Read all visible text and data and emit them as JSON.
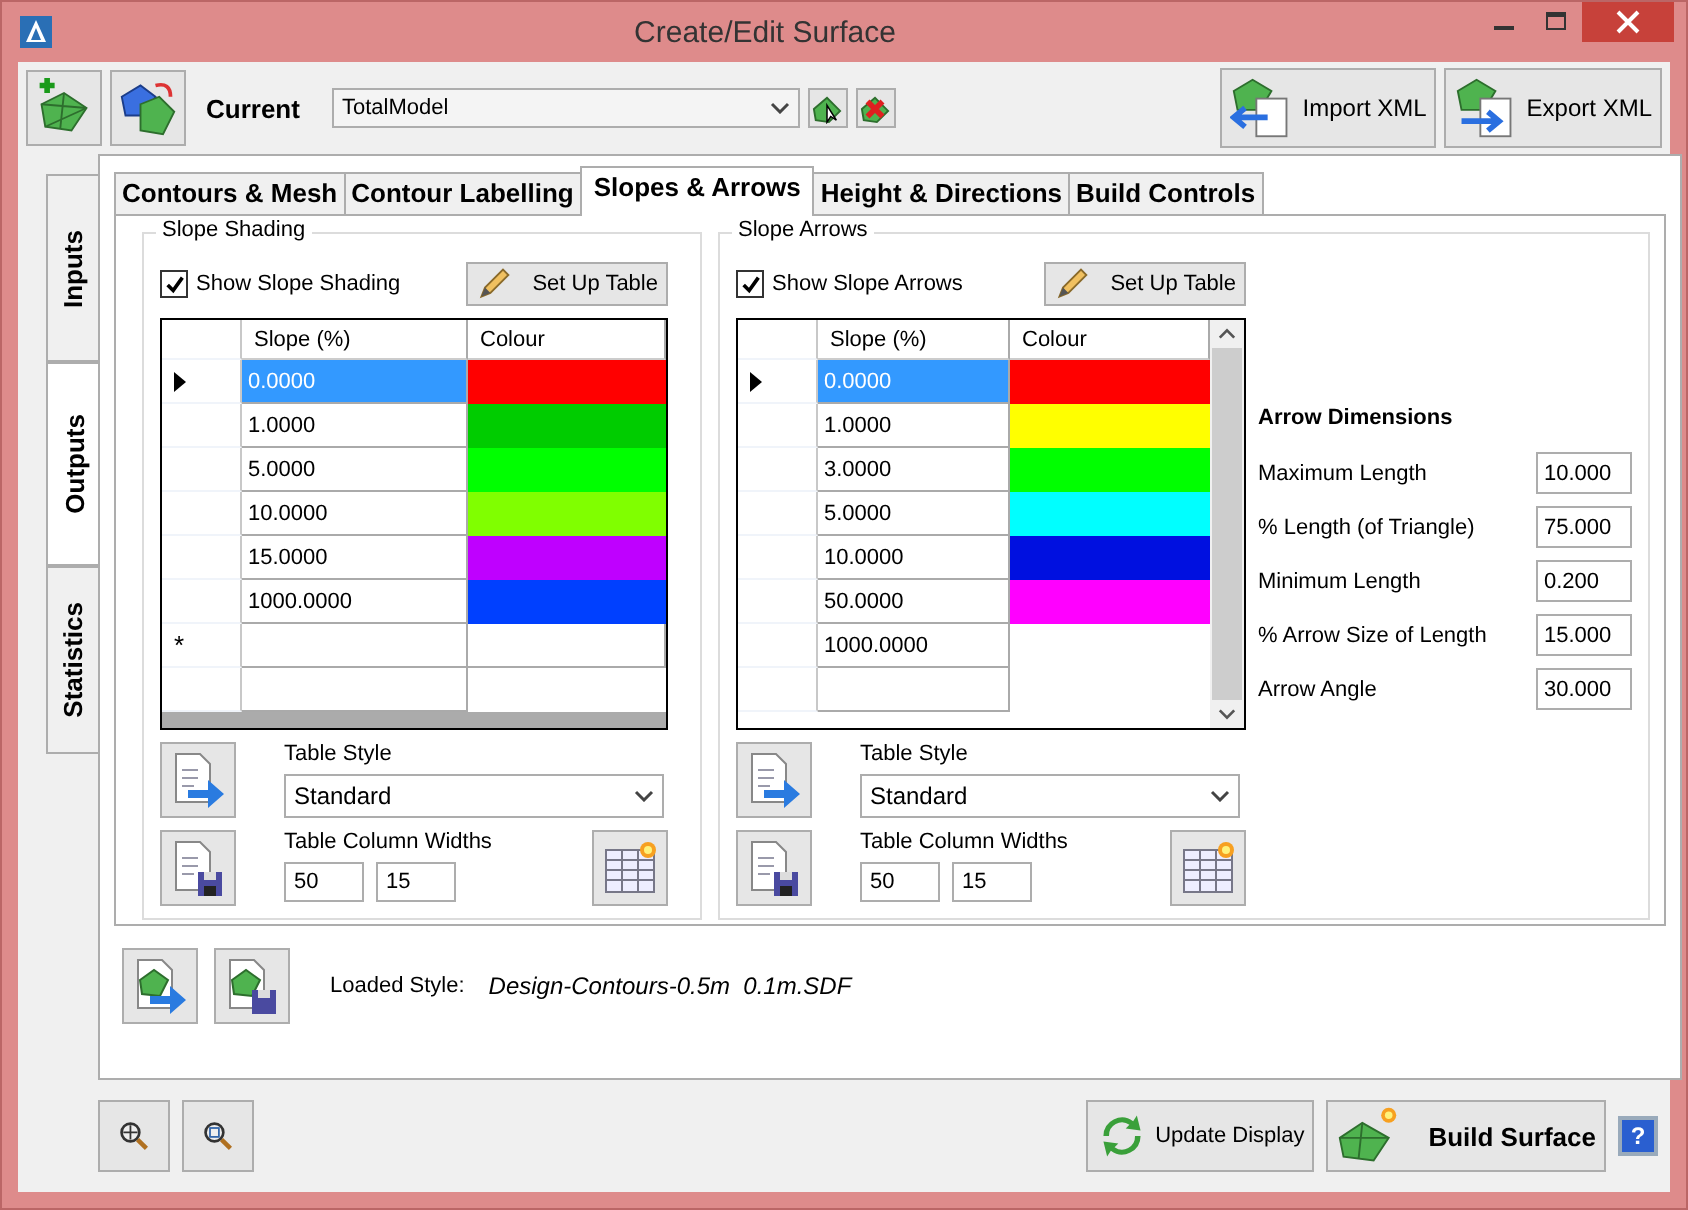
{
  "window": {
    "title": "Create/Edit Surface"
  },
  "toolbar": {
    "current_label": "Current",
    "current_value": "TotalModel",
    "import_button": "Import XML",
    "export_button": "Export XML"
  },
  "side_tabs": [
    {
      "label": "Inputs",
      "selected": false
    },
    {
      "label": "Outputs",
      "selected": true
    },
    {
      "label": "Statistics",
      "selected": false
    }
  ],
  "tabs": [
    {
      "label": "Contours & Mesh",
      "selected": false
    },
    {
      "label": "Contour Labelling",
      "selected": false
    },
    {
      "label": "Slopes & Arrows",
      "selected": true
    },
    {
      "label": "Height & Directions",
      "selected": false
    },
    {
      "label": "Build Controls",
      "selected": false
    }
  ],
  "panels": [
    {
      "title": "Slope Shading",
      "show_label": "Show Slope Shading",
      "checked": true,
      "setup_button": "Set Up Table",
      "columns": [
        "Slope (%)",
        "Colour"
      ],
      "scrollable": false,
      "new_row_marker": "*",
      "rows": [
        {
          "slope": "0.0000",
          "color": "#ff0000",
          "selected": true
        },
        {
          "slope": "1.0000",
          "color": "#00cc00",
          "selected": false
        },
        {
          "slope": "5.0000",
          "color": "#00ff00",
          "selected": false
        },
        {
          "slope": "10.0000",
          "color": "#80ff00",
          "selected": false
        },
        {
          "slope": "15.0000",
          "color": "#bf00ff",
          "selected": false
        },
        {
          "slope": "1000.0000",
          "color": "#0040ff",
          "selected": false
        }
      ],
      "table_style_label": "Table Style",
      "table_style": "Standard",
      "widths_label": "Table Column Widths",
      "widths": [
        "50",
        "15"
      ]
    },
    {
      "title": "Slope Arrows",
      "show_label": "Show Slope Arrows",
      "checked": true,
      "setup_button": "Set Up Table",
      "columns": [
        "Slope (%)",
        "Colour"
      ],
      "scrollable": true,
      "rows": [
        {
          "slope": "0.0000",
          "color": "#ff0000",
          "selected": true
        },
        {
          "slope": "1.0000",
          "color": "#ffff00",
          "selected": false
        },
        {
          "slope": "3.0000",
          "color": "#00ff00",
          "selected": false
        },
        {
          "slope": "5.0000",
          "color": "#00ffff",
          "selected": false
        },
        {
          "slope": "10.0000",
          "color": "#0010e0",
          "selected": false
        },
        {
          "slope": "50.0000",
          "color": "#ff00ff",
          "selected": false
        },
        {
          "slope": "1000.0000",
          "selected": false
        }
      ],
      "table_style_label": "Table Style",
      "table_style": "Standard",
      "widths_label": "Table Column Widths",
      "widths": [
        "50",
        "15"
      ]
    }
  ],
  "arrow_dimensions": {
    "title": "Arrow Dimensions",
    "fields": [
      {
        "label": "Maximum Length",
        "value": "10.000"
      },
      {
        "label": "% Length (of Triangle)",
        "value": "75.000"
      },
      {
        "label": "Minimum Length",
        "value": "0.200"
      },
      {
        "label": "% Arrow Size of Length",
        "value": "15.000"
      },
      {
        "label": "Arrow Angle",
        "value": "30.000"
      }
    ]
  },
  "loaded_style": {
    "label": "Loaded Style:",
    "value": "Design-Contours-0.5m  0.1m.SDF"
  },
  "footer": {
    "update_button": "Update Display",
    "build_button": "Build Surface",
    "help": "?"
  }
}
